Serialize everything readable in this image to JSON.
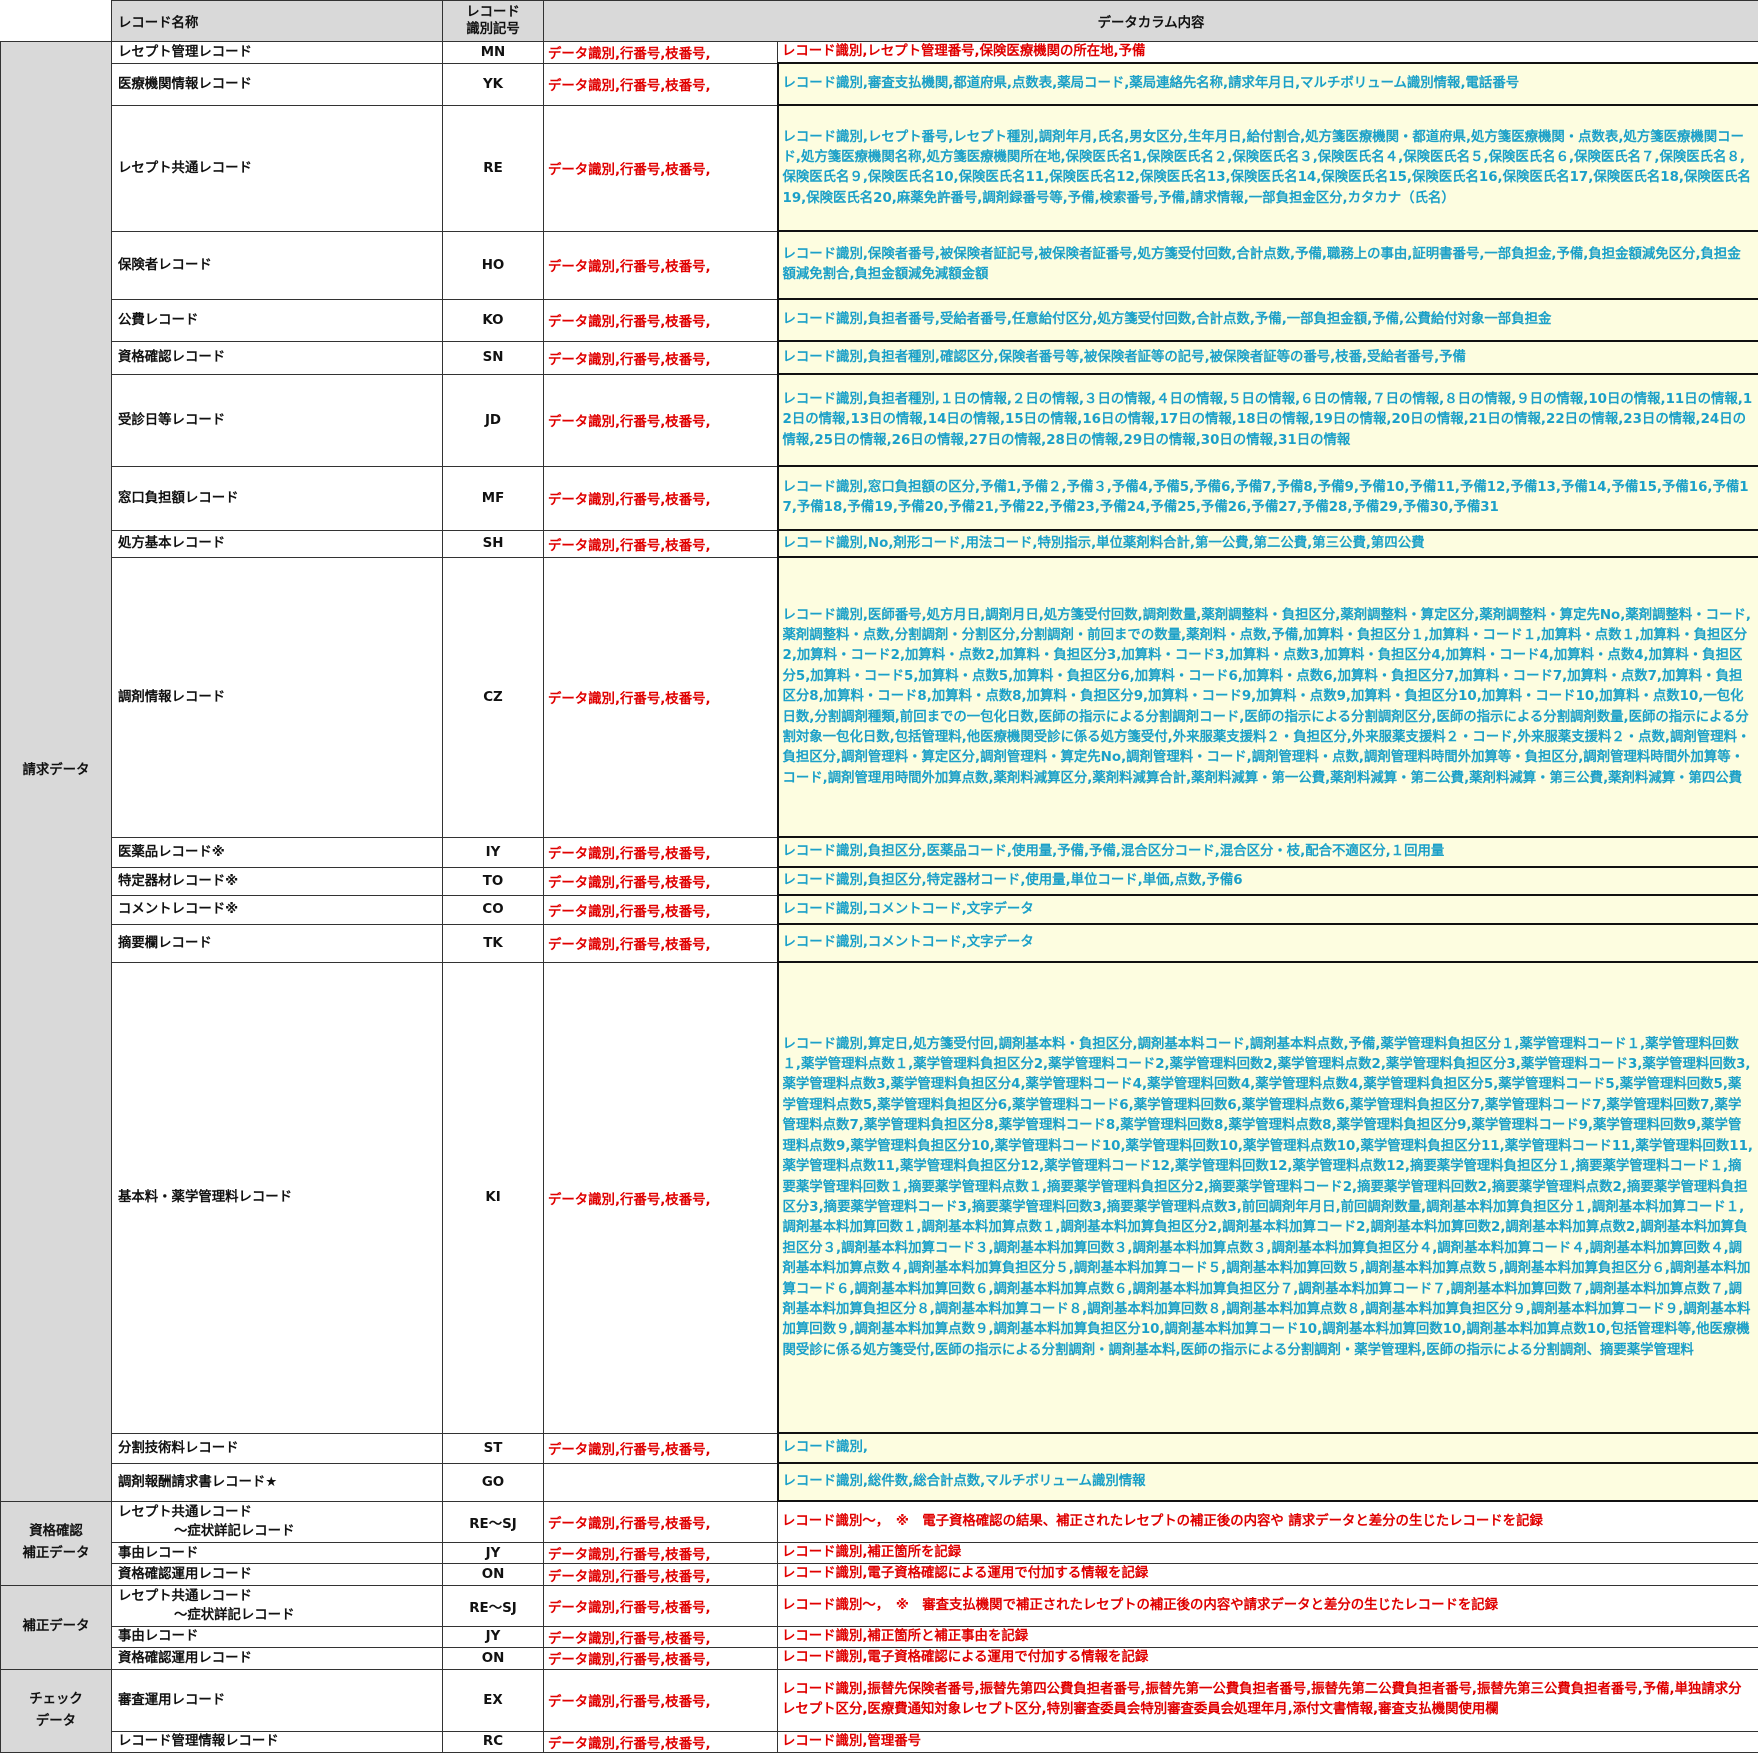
{
  "header": {
    "record_name": "レコード名称",
    "record_code": "レコード\n識別記号",
    "data_columns": "データカラム内容"
  },
  "common_prefix": "データ識別,行番号,枝番号,",
  "groups": [
    {
      "label": "請求データ"
    },
    {
      "label": "資格確認\n補正データ"
    },
    {
      "label": "補正データ"
    },
    {
      "label": "チェック\nデータ"
    }
  ],
  "rows": [
    {
      "name": "レセプト管理レコード",
      "code": "MN",
      "content": "レコード識別,レセプト管理番号,保険医療機関の所在地,予備"
    },
    {
      "name": "医療機関情報レコード",
      "code": "YK",
      "content": "レコード識別,審査支払機関,都道府県,点数表,薬局コード,薬局連絡先名称,請求年月日,マルチボリューム識別情報,電話番号"
    },
    {
      "name": "レセプト共通レコード",
      "code": "RE",
      "content": "レコード識別,レセプト番号,レセプト種別,調剤年月,氏名,男女区分,生年月日,給付割合,処方箋医療機関・都道府県,処方箋医療機関・点数表,処方箋医療機関コード,処方箋医療機関名称,処方箋医療機関所在地,保険医氏名1,保険医氏名２,保険医氏名３,保険医氏名４,保険医氏名５,保険医氏名６,保険医氏名７,保険医氏名８,保険医氏名９,保険医氏名10,保険医氏名11,保険医氏名12,保険医氏名13,保険医氏名14,保険医氏名15,保険医氏名16,保険医氏名17,保険医氏名18,保険医氏名19,保険医氏名20,麻薬免許番号,調剤録番号等,予備,検索番号,予備,請求情報,一部負担金区分,カタカナ（氏名）"
    },
    {
      "name": "保険者レコード",
      "code": "HO",
      "content": "レコード識別,保険者番号,被保険者証記号,被保険者証番号,処方箋受付回数,合計点数,予備,職務上の事由,証明書番号,一部負担金,予備,負担金額減免区分,負担金額減免割合,負担金額減免減額金額"
    },
    {
      "name": "公費レコード",
      "code": "KO",
      "content": "レコード識別,負担者番号,受給者番号,任意給付区分,処方箋受付回数,合計点数,予備,一部負担金額,予備,公費給付対象一部負担金"
    },
    {
      "name": "資格確認レコード",
      "code": "SN",
      "content": "レコード識別,負担者種別,確認区分,保険者番号等,被保険者証等の記号,被保険者証等の番号,枝番,受給者番号,予備"
    },
    {
      "name": "受診日等レコード",
      "code": "JD",
      "content": "レコード識別,負担者種別,１日の情報,２日の情報,３日の情報,４日の情報,５日の情報,６日の情報,７日の情報,８日の情報,９日の情報,10日の情報,11日の情報,12日の情報,13日の情報,14日の情報,15日の情報,16日の情報,17日の情報,18日の情報,19日の情報,20日の情報,21日の情報,22日の情報,23日の情報,24日の情報,25日の情報,26日の情報,27日の情報,28日の情報,29日の情報,30日の情報,31日の情報"
    },
    {
      "name": "窓口負担額レコード",
      "code": "MF",
      "content": "レコード識別,窓口負担額の区分,予備1,予備２,予備３,予備4,予備5,予備6,予備7,予備8,予備9,予備10,予備11,予備12,予備13,予備14,予備15,予備16,予備17,予備18,予備19,予備20,予備21,予備22,予備23,予備24,予備25,予備26,予備27,予備28,予備29,予備30,予備31"
    },
    {
      "name": "処方基本レコード",
      "code": "SH",
      "content": "レコード識別,No,剤形コード,用法コード,特別指示,単位薬剤料合計,第一公費,第二公費,第三公費,第四公費"
    },
    {
      "name": "調剤情報レコード",
      "code": "CZ",
      "content": "レコード識別,医師番号,処方月日,調剤月日,処方箋受付回数,調剤数量,薬剤調整料・負担区分,薬剤調整料・算定区分,薬剤調整料・算定先No,薬剤調整料・コード,薬剤調整料・点数,分割調剤・分割区分,分割調剤・前回までの数量,薬剤料・点数,予備,加算料・負担区分１,加算料・コード１,加算料・点数１,加算料・負担区分2,加算料・コード2,加算料・点数2,加算料・負担区分3,加算料・コード3,加算料・点数3,加算料・負担区分4,加算料・コード4,加算料・点数4,加算料・負担区分5,加算料・コード5,加算料・点数5,加算料・負担区分6,加算料・コード6,加算料・点数6,加算料・負担区分7,加算料・コード7,加算料・点数7,加算料・負担区分8,加算料・コード8,加算料・点数8,加算料・負担区分9,加算料・コード9,加算料・点数9,加算料・負担区分10,加算料・コード10,加算料・点数10,一包化日数,分割調剤種類,前回までの一包化日数,医師の指示による分割調剤コード,医師の指示による分割調剤区分,医師の指示による分割調剤数量,医師の指示による分割対象一包化日数,包括管理料,他医療機関受診に係る処方箋受付,外来服薬支援料２・負担区分,外来服薬支援料２・コード,外来服薬支援料２・点数,調剤管理料・負担区分,調剤管理料・算定区分,調剤管理料・算定先No,調剤管理料・コード,調剤管理料・点数,調剤管理料時間外加算等・負担区分,調剤管理料時間外加算等・コード,調剤管理用時間外加算点数,薬剤料減算区分,薬剤料減算合計,薬剤料減算・第一公費,薬剤料減算・第二公費,薬剤料減算・第三公費,薬剤料減算・第四公費"
    },
    {
      "name": "医薬品レコード※",
      "code": "IY",
      "content": "レコード識別,負担区分,医薬品コード,使用量,予備,予備,混合区分コード,混合区分・枝,配合不適区分,１回用量"
    },
    {
      "name": "特定器材レコード※",
      "code": "TO",
      "content": "レコード識別,負担区分,特定器材コード,使用量,単位コード,単価,点数,予備6"
    },
    {
      "name": "コメントレコード※",
      "code": "CO",
      "content": "レコード識別,コメントコード,文字データ"
    },
    {
      "name": "摘要欄レコード",
      "code": "TK",
      "content": "レコード識別,コメントコード,文字データ"
    },
    {
      "name": "基本料・薬学管理料レコード",
      "code": "KI",
      "content": "レコード識別,算定日,処方箋受付回,調剤基本料・負担区分,調剤基本料コード,調剤基本料点数,予備,薬学管理料負担区分１,薬学管理料コード１,薬学管理料回数１,薬学管理料点数１,薬学管理料負担区分2,薬学管理料コード2,薬学管理料回数2,薬学管理料点数2,薬学管理料負担区分3,薬学管理料コード3,薬学管理料回数3,薬学管理料点数3,薬学管理料負担区分4,薬学管理料コード4,薬学管理料回数4,薬学管理料点数4,薬学管理料負担区分5,薬学管理料コード5,薬学管理料回数5,薬学管理料点数5,薬学管理料負担区分6,薬学管理料コード6,薬学管理料回数6,薬学管理料点数6,薬学管理料負担区分7,薬学管理料コード7,薬学管理料回数7,薬学管理料点数7,薬学管理料負担区分8,薬学管理料コード8,薬学管理料回数8,薬学管理料点数8,薬学管理料負担区分9,薬学管理料コード9,薬学管理料回数9,薬学管理料点数9,薬学管理料負担区分10,薬学管理料コード10,薬学管理料回数10,薬学管理料点数10,薬学管理料負担区分11,薬学管理料コード11,薬学管理料回数11,薬学管理料点数11,薬学管理料負担区分12,薬学管理料コード12,薬学管理料回数12,薬学管理料点数12,摘要薬学管理料負担区分１,摘要薬学管理料コード１,摘要薬学管理料回数１,摘要薬学管理料点数１,摘要薬学管理料負担区分2,摘要薬学管理料コード2,摘要薬学管理料回数2,摘要薬学管理料点数2,摘要薬学管理料負担区分3,摘要薬学管理料コード3,摘要薬学管理料回数3,摘要薬学管理料点数3,前回調剤年月日,前回調剤数量,調剤基本料加算負担区分１,調剤基本料加算コード１,調剤基本料加算回数１,調剤基本料加算点数１,調剤基本料加算負担区分2,調剤基本料加算コード2,調剤基本料加算回数2,調剤基本料加算点数2,調剤基本料加算負担区分３,調剤基本料加算コード３,調剤基本料加算回数３,調剤基本料加算点数３,調剤基本料加算負担区分４,調剤基本料加算コード４,調剤基本料加算回数４,調剤基本料加算点数４,調剤基本料加算負担区分５,調剤基本料加算コード５,調剤基本料加算回数５,調剤基本料加算点数５,調剤基本料加算負担区分６,調剤基本料加算コード６,調剤基本料加算回数６,調剤基本料加算点数６,調剤基本料加算負担区分７,調剤基本料加算コード７,調剤基本料加算回数７,調剤基本料加算点数７,調剤基本料加算負担区分８,調剤基本料加算コード８,調剤基本料加算回数８,調剤基本料加算点数８,調剤基本料加算負担区分９,調剤基本料加算コード９,調剤基本料加算回数９,調剤基本料加算点数９,調剤基本料加算負担区分10,調剤基本料加算コード10,調剤基本料加算回数10,調剤基本料加算点数10,包括管理料等,他医療機関受診に係る処方箋受付,医師の指示による分割調剤・調剤基本料,医師の指示による分割調剤・薬学管理料,医師の指示による分割調剤、摘要薬学管理料"
    },
    {
      "name": "分割技術料レコード",
      "code": "ST",
      "content": "レコード識別,"
    },
    {
      "name": "調剤報酬請求書レコード★",
      "code": "GO",
      "content": "レコード識別,総件数,総合計点数,マルチボリューム識別情報"
    },
    {
      "name": "レセプト共通レコード\n〜症状詳記レコード",
      "code": "RE〜SJ",
      "content": "レコード識別〜，　※　電子資格確認の結果、補正されたレセプトの補正後の内容や 請求データと差分の生じたレコードを記録"
    },
    {
      "name": "事由レコード",
      "code": "JY",
      "content": "レコード識別,補正箇所を記録"
    },
    {
      "name": "資格確認運用レコード",
      "code": "ON",
      "content": "レコード識別,電子資格確認による運用で付加する情報を記録"
    },
    {
      "name": "レセプト共通レコード\n〜症状詳記レコード",
      "code": "RE〜SJ",
      "content": "レコード識別〜，　※　審査支払機関で補正されたレセプトの補正後の内容や請求データと差分の生じたレコードを記録"
    },
    {
      "name": "事由レコード",
      "code": "JY",
      "content": "レコード識別,補正箇所と補正事由を記録"
    },
    {
      "name": "資格確認運用レコード",
      "code": "ON",
      "content": "レコード識別,電子資格確認による運用で付加する情報を記録"
    },
    {
      "name": "審査運用レコード",
      "code": "EX",
      "content": "レコード識別,振替先保険者番号,振替先第四公費負担者番号,振替先第一公費負担者番号,振替先第二公費負担者番号,振替先第三公費負担者番号,予備,単独請求分レセプト区分,医療費通知対象レセプト区分,特別審査委員会特別審査委員会処理年月,添付文書情報,審査支払機関使用欄"
    },
    {
      "name": "レコード管理情報レコード",
      "code": "RC",
      "content": "レコード識別,管理番号"
    }
  ],
  "colors": {
    "header_bg": "#d9d9d9",
    "red_text": "#e00000",
    "blue_text": "#1ba0c8",
    "highlight_bg": "#fdfde0"
  }
}
